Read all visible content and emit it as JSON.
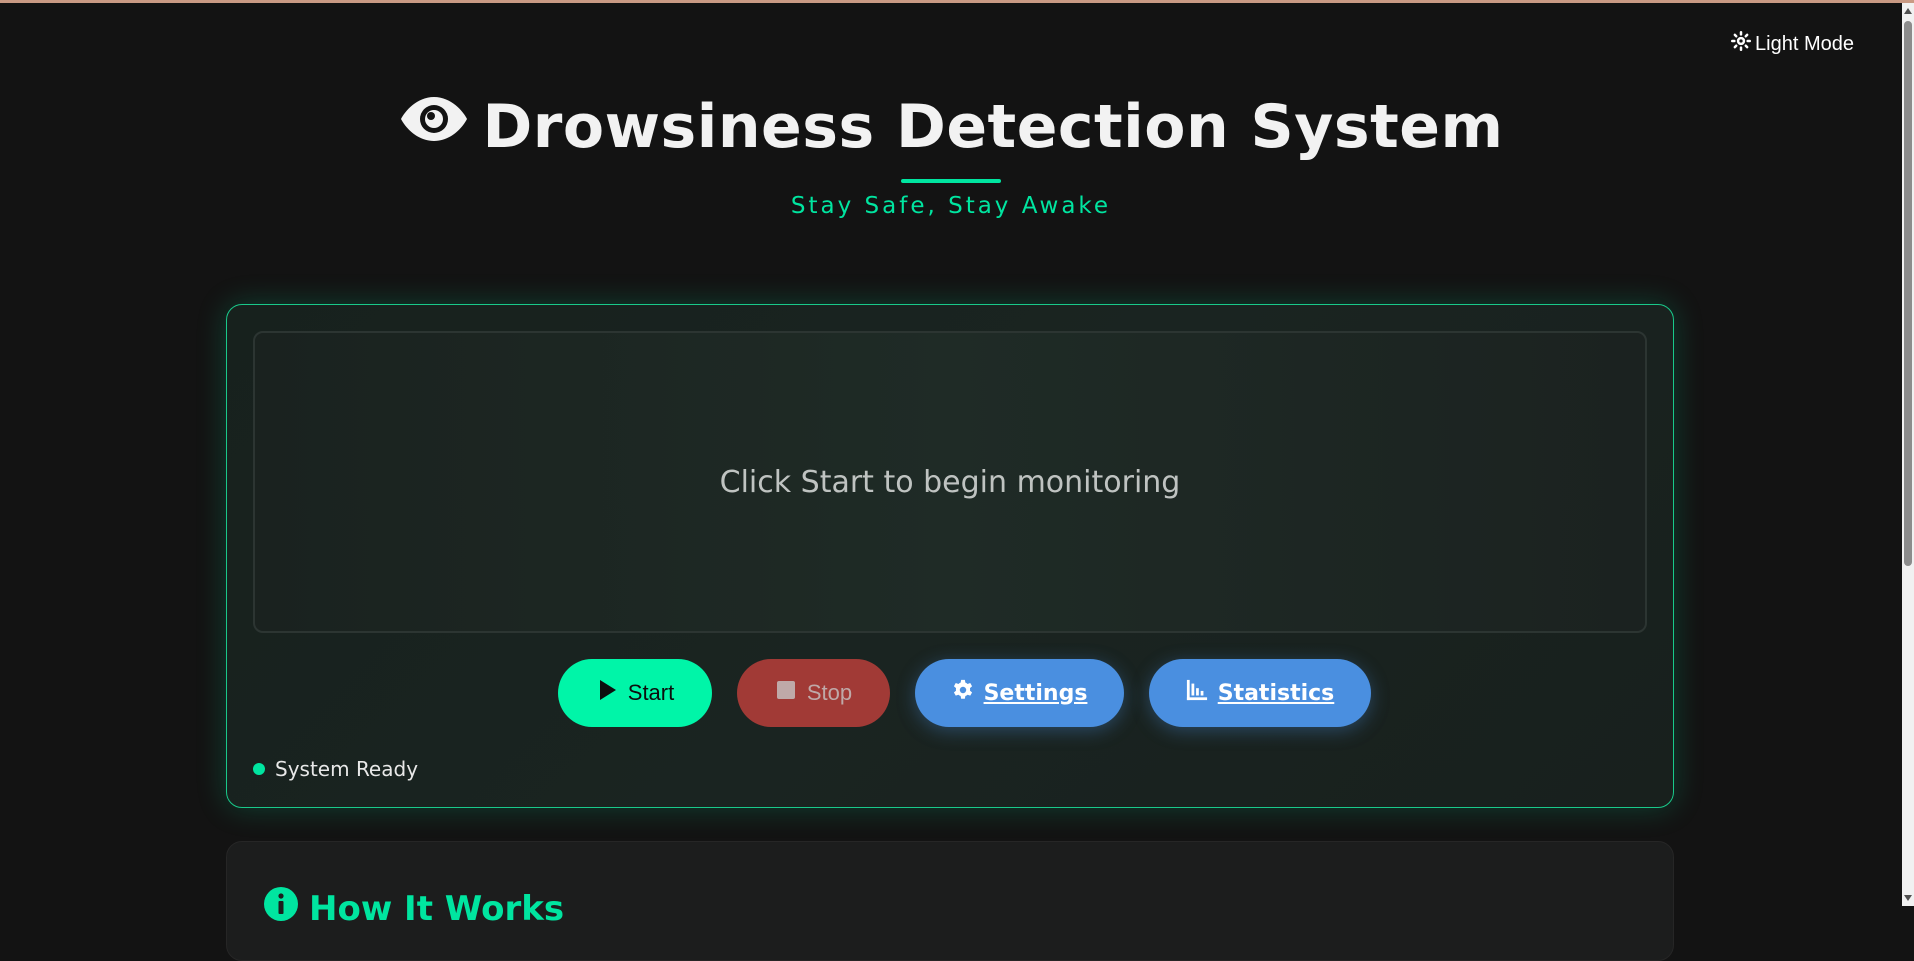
{
  "theme_toggle": {
    "label": "Light Mode",
    "icon": "sun-icon"
  },
  "header": {
    "title": "Drowsiness Detection System",
    "title_icon": "eye-icon",
    "subtitle": "Stay Safe, Stay Awake"
  },
  "monitor": {
    "placeholder": "Click Start to begin monitoring",
    "buttons": {
      "start": {
        "label": "Start",
        "icon": "play-icon"
      },
      "stop": {
        "label": "Stop",
        "icon": "stop-icon"
      },
      "settings": {
        "label": "Settings",
        "icon": "gear-icon"
      },
      "statistics": {
        "label": "Statistics",
        "icon": "bar-chart-icon"
      }
    },
    "status": "System Ready"
  },
  "info": {
    "title": "How It Works",
    "icon": "info-icon"
  },
  "colors": {
    "accent": "#00e5a0",
    "start_button": "#00f5a8",
    "stop_button": "#a13a36",
    "secondary_button": "#4a8fe0",
    "background": "#131313"
  }
}
